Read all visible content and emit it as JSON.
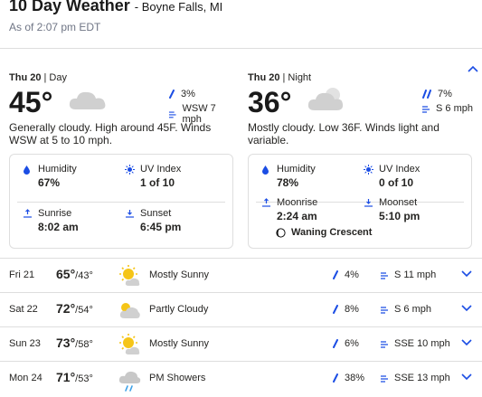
{
  "header": {
    "title": "10 Day Weather",
    "location": "- Boyne Falls, MI",
    "as_of": "As of 2:07 pm EDT"
  },
  "day": {
    "label_day": "Thu 20",
    "label_part": "| Day",
    "temp": "45°",
    "icon": "cloudy-icon",
    "precip": "3%",
    "wind": "WSW 7 mph",
    "narrative": "Generally cloudy. High around 45F. Winds WSW at 5 to 10 mph.",
    "humidity_label": "Humidity",
    "humidity": "67%",
    "uv_label": "UV Index",
    "uv": "1 of 10",
    "sunrise_label": "Sunrise",
    "sunrise": "8:02 am",
    "sunset_label": "Sunset",
    "sunset": "6:45 pm"
  },
  "night": {
    "label_day": "Thu 20",
    "label_part": "| Night",
    "temp": "36°",
    "icon": "mostly-cloudy-night-icon",
    "precip": "7%",
    "wind": "S 6 mph",
    "narrative": "Mostly cloudy. Low 36F. Winds light and variable.",
    "humidity_label": "Humidity",
    "humidity": "78%",
    "uv_label": "UV Index",
    "uv": "0 of 10",
    "moonrise_label": "Moonrise",
    "moonrise": "2:24 am",
    "moonset_label": "Moonset",
    "moonset": "5:10 pm",
    "moon_phase": "Waning Crescent"
  },
  "forecast": [
    {
      "day": "Fri 21",
      "hi": "65°",
      "lo": "/43°",
      "cond": "Mostly Sunny",
      "icon": "mostly-sunny-icon",
      "precip": "4%",
      "wind": "S 11 mph"
    },
    {
      "day": "Sat 22",
      "hi": "72°",
      "lo": "/54°",
      "cond": "Partly Cloudy",
      "icon": "partly-cloudy-icon",
      "precip": "8%",
      "wind": "S 6 mph"
    },
    {
      "day": "Sun 23",
      "hi": "73°",
      "lo": "/58°",
      "cond": "Mostly Sunny",
      "icon": "mostly-sunny-icon",
      "precip": "6%",
      "wind": "SSE 10 mph"
    },
    {
      "day": "Mon 24",
      "hi": "71°",
      "lo": "/53°",
      "cond": "PM Showers",
      "icon": "showers-icon",
      "precip": "38%",
      "wind": "SSE 13 mph"
    }
  ],
  "colors": {
    "accent": "#1b4de4",
    "text": "#252422",
    "muted": "#6f7585",
    "divider": "#dedede"
  }
}
